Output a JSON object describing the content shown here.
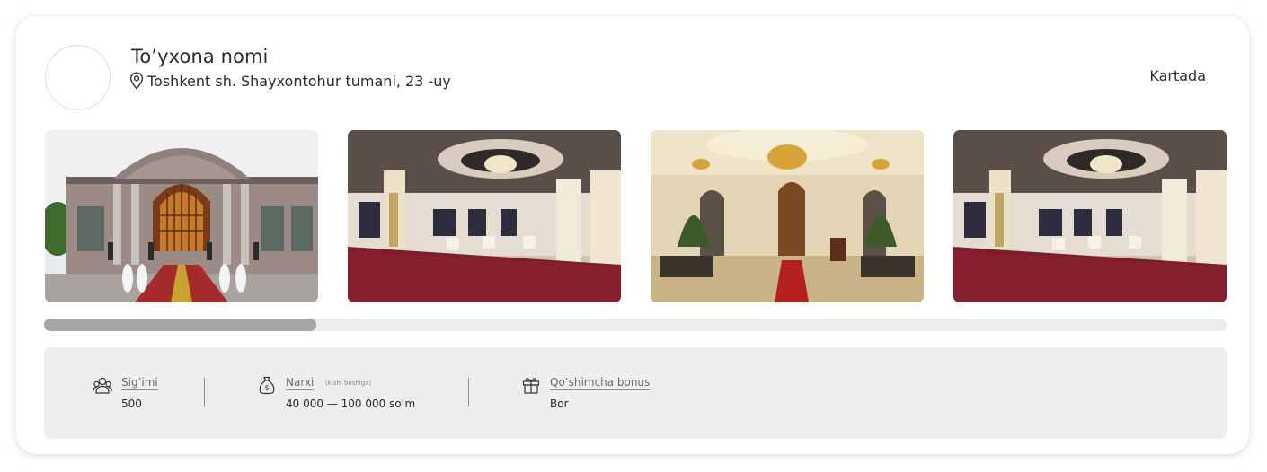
{
  "venue": {
    "name": "To’yxona nomi",
    "address": "Toshkent sh. Shayxontohur tumani, 23 -uy",
    "map_link": "Kartada"
  },
  "gallery": {
    "photos": [
      "exterior",
      "hall-interior",
      "hall-entrance",
      "hall-interior"
    ],
    "scroll_position": 0.23
  },
  "stats": {
    "capacity": {
      "label": "Sig’imi",
      "value": "500",
      "icon": "people-icon"
    },
    "price": {
      "label": "Narxi",
      "note": "(kishi boshiga)",
      "value": "40 000 — 100 000 so‘m",
      "icon": "money-bag-icon"
    },
    "bonus": {
      "label": "Qo‘shimcha bonus",
      "value": "Bor",
      "icon": "gift-icon"
    }
  }
}
